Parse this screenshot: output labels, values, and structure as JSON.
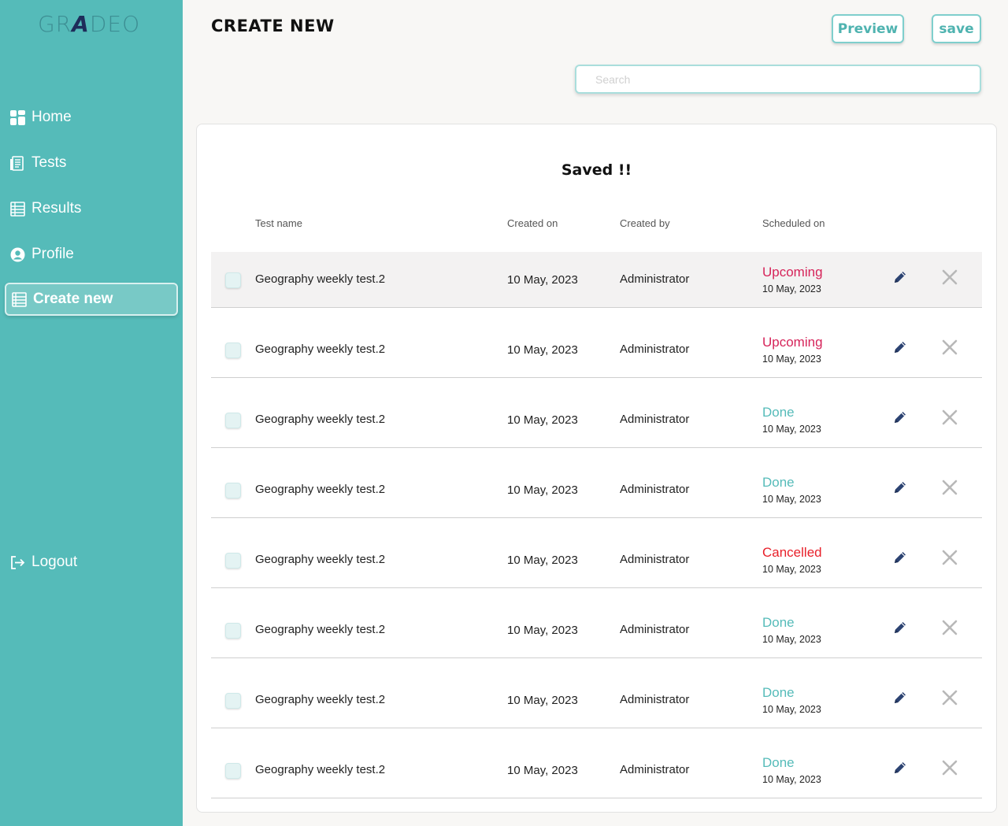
{
  "app": {
    "logo_left": "GR",
    "logo_mid": "A",
    "logo_right": "DEO"
  },
  "sidebar": {
    "items": [
      {
        "label": "Home",
        "icon": "dashboard-icon"
      },
      {
        "label": "Tests",
        "icon": "tests-icon"
      },
      {
        "label": "Results",
        "icon": "results-icon"
      },
      {
        "label": "Profile",
        "icon": "profile-icon"
      },
      {
        "label": "Create new",
        "icon": "create-new-icon",
        "active": true
      }
    ],
    "logout": {
      "label": "Logout",
      "icon": "logout-icon"
    }
  },
  "header": {
    "title": "CREATE NEW",
    "preview_label": "Preview",
    "save_label": "save",
    "search_placeholder": "Search"
  },
  "card": {
    "saved_message": "Saved !!",
    "columns": [
      "Test name",
      "Created on",
      "Created by",
      "Scheduled on"
    ]
  },
  "colors": {
    "sidebar": "#55bbb9",
    "accent": "#4fb3b0",
    "upcoming": "#d6245a",
    "done": "#55bbb9",
    "cancelled": "#e8202a",
    "edit_icon": "#2c4372"
  },
  "rows": [
    {
      "name": "Geography weekly test.2",
      "created_on": "10 May, 2023",
      "created_by": "Administrator",
      "status": "Upcoming",
      "status_type": "upcoming",
      "scheduled": "10 May, 2023"
    },
    {
      "name": "Geography weekly test.2",
      "created_on": "10 May, 2023",
      "created_by": "Administrator",
      "status": "Upcoming",
      "status_type": "upcoming",
      "scheduled": "10 May, 2023"
    },
    {
      "name": "Geography weekly test.2",
      "created_on": "10 May, 2023",
      "created_by": "Administrator",
      "status": "Done",
      "status_type": "done",
      "scheduled": "10 May, 2023"
    },
    {
      "name": "Geography weekly test.2",
      "created_on": "10 May, 2023",
      "created_by": "Administrator",
      "status": "Done",
      "status_type": "done",
      "scheduled": "10 May, 2023"
    },
    {
      "name": "Geography weekly test.2",
      "created_on": "10 May, 2023",
      "created_by": "Administrator",
      "status": "Cancelled",
      "status_type": "cancelled",
      "scheduled": "10 May, 2023"
    },
    {
      "name": "Geography weekly test.2",
      "created_on": "10 May, 2023",
      "created_by": "Administrator",
      "status": "Done",
      "status_type": "done",
      "scheduled": "10 May, 2023"
    },
    {
      "name": "Geography weekly test.2",
      "created_on": "10 May, 2023",
      "created_by": "Administrator",
      "status": "Done",
      "status_type": "done",
      "scheduled": "10 May, 2023"
    },
    {
      "name": "Geography weekly test.2",
      "created_on": "10 May, 2023",
      "created_by": "Administrator",
      "status": "Done",
      "status_type": "done",
      "scheduled": "10 May, 2023"
    }
  ]
}
